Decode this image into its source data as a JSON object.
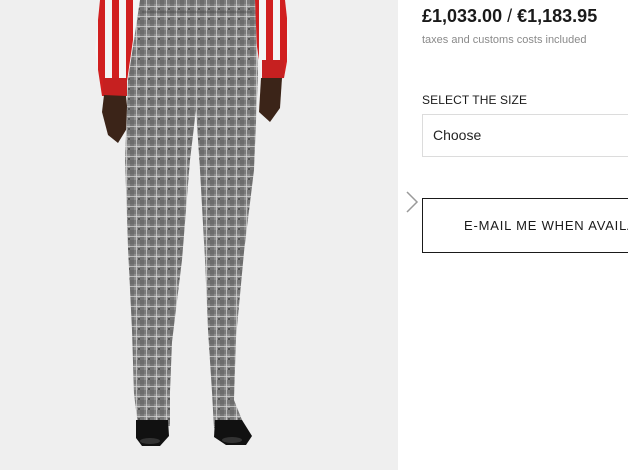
{
  "product": {
    "price_gbp": "£1,033.00",
    "price_separator": "/",
    "price_eur": "€1,183.95",
    "tax_note": "taxes and customs costs included",
    "size_label": "SELECT THE SIZE",
    "size_select_value": "Choose",
    "notify_button_label": "E-MAIL ME WHEN AVAILA"
  },
  "image": {
    "subject": "model wearing grey check slim trousers, red and white striped shirt, black pointed heels"
  },
  "icons": {
    "carousel_arrow": "chevron-right-icon"
  },
  "colors": {
    "text": "#1a1a1a",
    "muted": "#8a8a8a",
    "border": "#dcdcdc",
    "photo_bg": "#efefef"
  }
}
